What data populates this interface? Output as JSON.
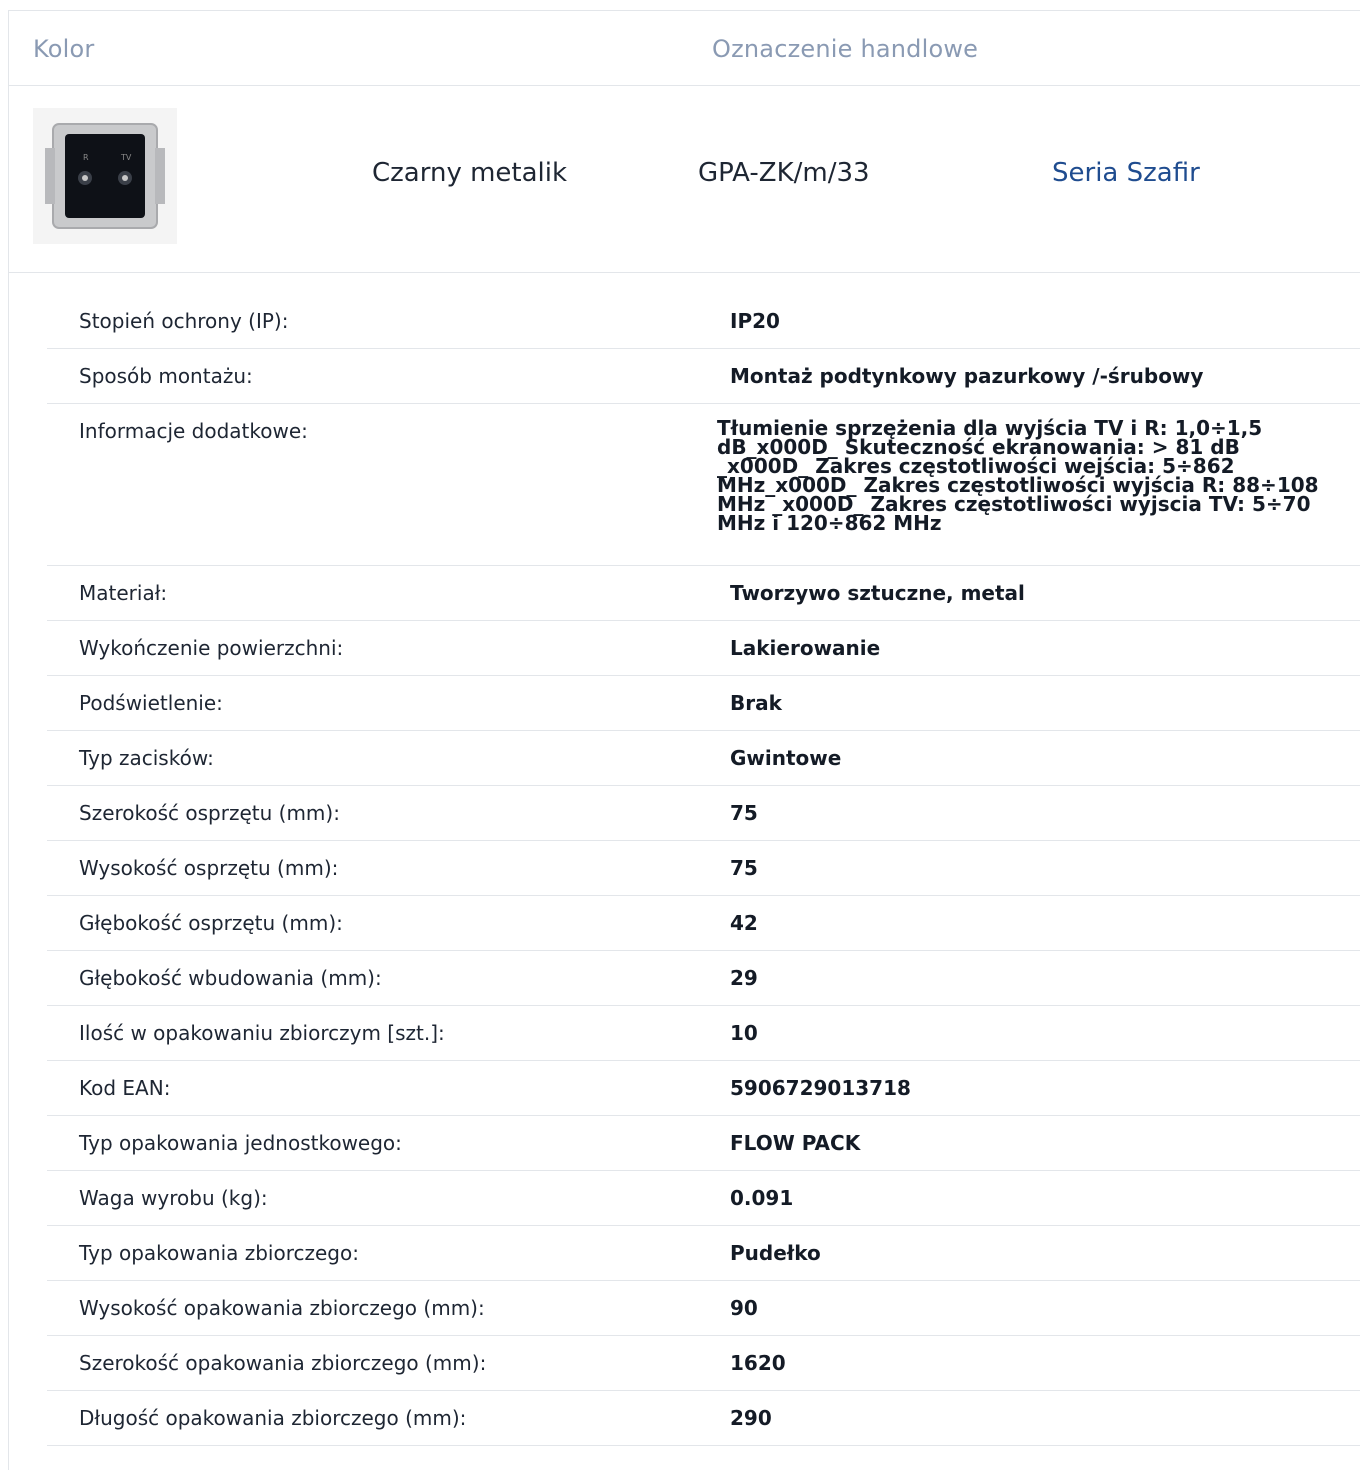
{
  "header": {
    "color_col": "Kolor",
    "trade_col": "Oznaczenie handlowe"
  },
  "product": {
    "image_icon": "tv-socket-icon",
    "color": "Czarny metalik",
    "code": "GPA-ZK/m/33",
    "series_link": "Seria Szafir"
  },
  "specs": [
    {
      "label": "Stopień ochrony (IP):",
      "value": "IP20"
    },
    {
      "label": "Sposób montażu:",
      "value": "Montaż podtynkowy pazurkowy /-śrubowy"
    },
    {
      "label": "Informacje dodatkowe:",
      "value": "  Tłumienie sprzężenia dla wyjścia TV i R: 1,0÷1,5 dB_x000D_ Skuteczność ekranowania: > 81 dB _x000D_ Zakres częstotliwości wejścia: 5÷862 MHz_x000D_ Zakres częstotliwości wyjścia R: 88÷108 MHz _x000D_ Zakres częstotliwości wyjscia TV: 5÷70 MHz i 120÷862 MHz"
    },
    {
      "label": "Materiał:",
      "value": "Tworzywo sztuczne, metal"
    },
    {
      "label": "Wykończenie powierzchni:",
      "value": "Lakierowanie"
    },
    {
      "label": "Podświetlenie:",
      "value": "Brak"
    },
    {
      "label": "Typ zacisków:",
      "value": "Gwintowe"
    },
    {
      "label": "Szerokość osprzętu (mm):",
      "value": "75"
    },
    {
      "label": "Wysokość osprzętu (mm):",
      "value": "75"
    },
    {
      "label": "Głębokość osprzętu (mm):",
      "value": "42"
    },
    {
      "label": "Głębokość wbudowania (mm):",
      "value": "29"
    },
    {
      "label": "Ilość w opakowaniu zbiorczym [szt.]:",
      "value": "10"
    },
    {
      "label": "Kod EAN:",
      "value": "5906729013718"
    },
    {
      "label": "Typ opakowania jednostkowego:",
      "value": "FLOW PACK"
    },
    {
      "label": "Waga wyrobu (kg):",
      "value": "0.091"
    },
    {
      "label": "Typ opakowania zbiorczego:",
      "value": "Pudełko"
    },
    {
      "label": "Wysokość opakowania zbiorczego (mm):",
      "value": "90"
    },
    {
      "label": "Szerokość opakowania zbiorczego (mm):",
      "value": "1620"
    },
    {
      "label": "Długość opakowania zbiorczego (mm):",
      "value": "290"
    }
  ]
}
